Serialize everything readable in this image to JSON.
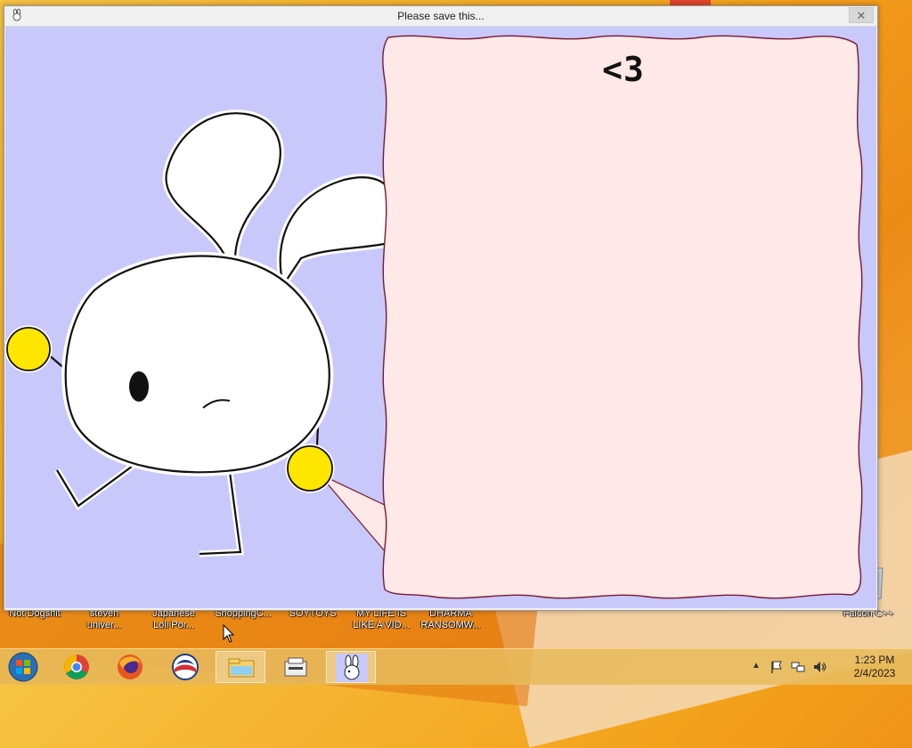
{
  "window": {
    "title": "Please save this...",
    "close_glyph": "✕",
    "message": "<3"
  },
  "desktop": {
    "icons": [
      {
        "label": "Not Dogshit",
        "line2": ""
      },
      {
        "label": "steven",
        "line2": "univer..."
      },
      {
        "label": "Japanese",
        "line2": "Loli Por..."
      },
      {
        "label": "ShoppingC...",
        "line2": ""
      },
      {
        "label": "SOYTOYS",
        "line2": ""
      },
      {
        "label": "MY LIFE IS",
        "line2": "LIKE A VID..."
      },
      {
        "label": "DHARMA",
        "line2": "RANSOMW..."
      },
      {
        "label": "Falcon C++",
        "line2": ""
      }
    ]
  },
  "taskbar": {
    "apps": [
      "start-orb",
      "chrome-icon",
      "firefox-icon",
      "obama-icon",
      "file-explorer-icon",
      "printer-app-icon",
      "bunny-app-icon"
    ],
    "clock_time": "1:23 PM",
    "clock_date": "2/4/2023"
  },
  "colors": {
    "canvas_bg": "#c9c8fb",
    "speech_bubble": "#ffe8e8",
    "speech_outline": "#7a1830",
    "accent_yellow": "#ffe600"
  }
}
